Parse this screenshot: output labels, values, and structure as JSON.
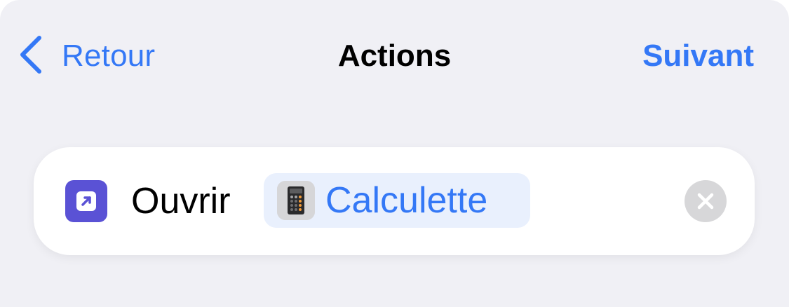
{
  "nav": {
    "back_label": "Retour",
    "title": "Actions",
    "next_label": "Suivant"
  },
  "action": {
    "verb": "Ouvrir",
    "app_name": "Calculette",
    "app_icon": "calculator-icon",
    "action_icon": "open-app-icon",
    "clear_icon": "close-icon"
  },
  "colors": {
    "accent": "#3478f6",
    "background": "#f0f0f5",
    "action_icon_bg": "#5a52d5",
    "chip_bg": "#e9f0fd"
  }
}
